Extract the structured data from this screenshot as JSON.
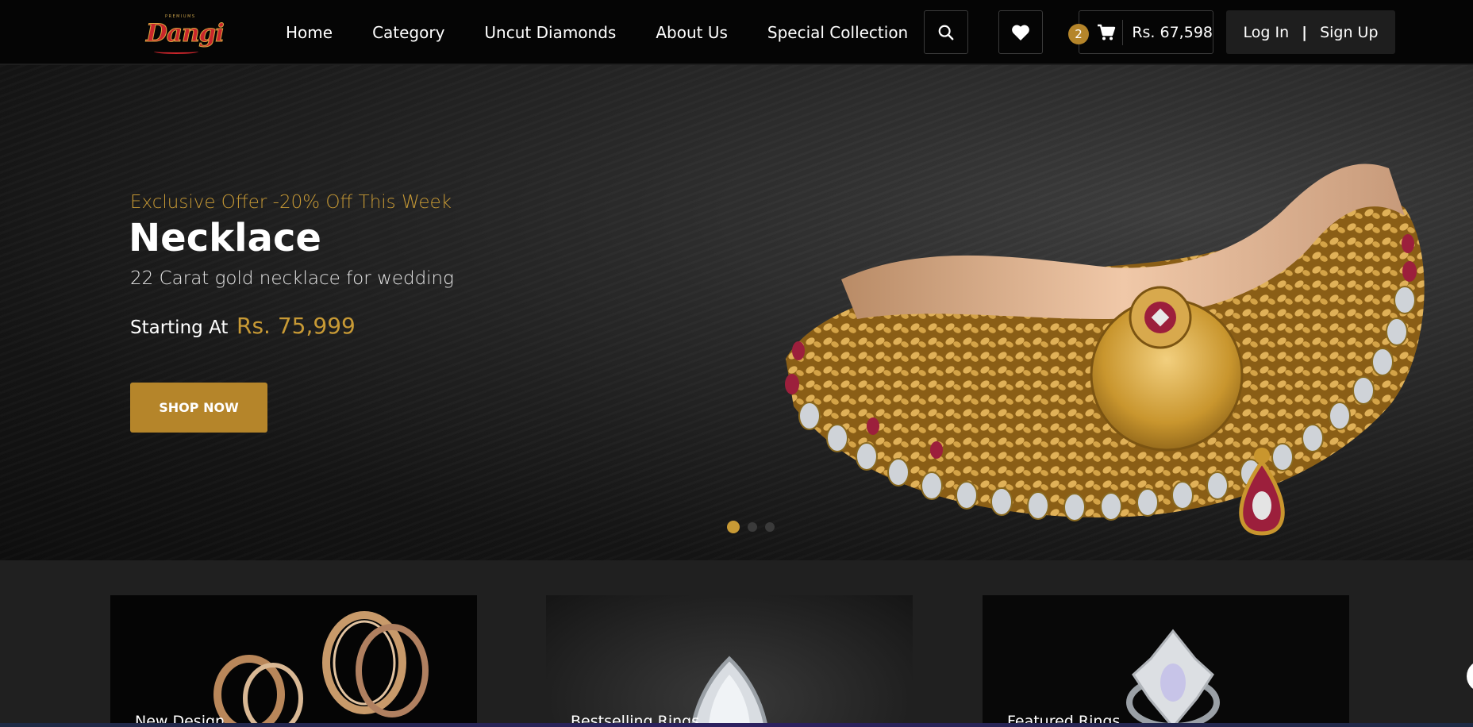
{
  "logo": {
    "top": "PREMIUMS",
    "word": "Dangi"
  },
  "nav": {
    "items": [
      {
        "label": "Home"
      },
      {
        "label": "Category"
      },
      {
        "label": "Uncut Diamonds"
      },
      {
        "label": "About Us"
      },
      {
        "label": "Special Collection"
      }
    ]
  },
  "header": {
    "search_icon": "search-icon",
    "wishlist_icon": "heart-icon",
    "cart": {
      "count": "2",
      "total": "Rs. 67,598",
      "icon": "cart-icon"
    },
    "login_label": "Log In",
    "separator": "|",
    "signup_label": "Sign Up"
  },
  "hero": {
    "offer": "Exclusive Offer -20% Off This Week",
    "title": "Necklace",
    "subtitle": "22 Carat gold necklace for wedding",
    "starting_label": "Starting At",
    "price": "Rs. 75,999",
    "cta": "SHOP NOW",
    "slides": 3,
    "active_slide": 1
  },
  "cards": [
    {
      "label": "New Design"
    },
    {
      "label": "Bestselling Rings"
    },
    {
      "label": "Featured Rings"
    }
  ],
  "colors": {
    "accent": "#b5852a",
    "accent_text": "#c89a35",
    "nav_bg": "#050505",
    "section_bg": "#202020"
  }
}
